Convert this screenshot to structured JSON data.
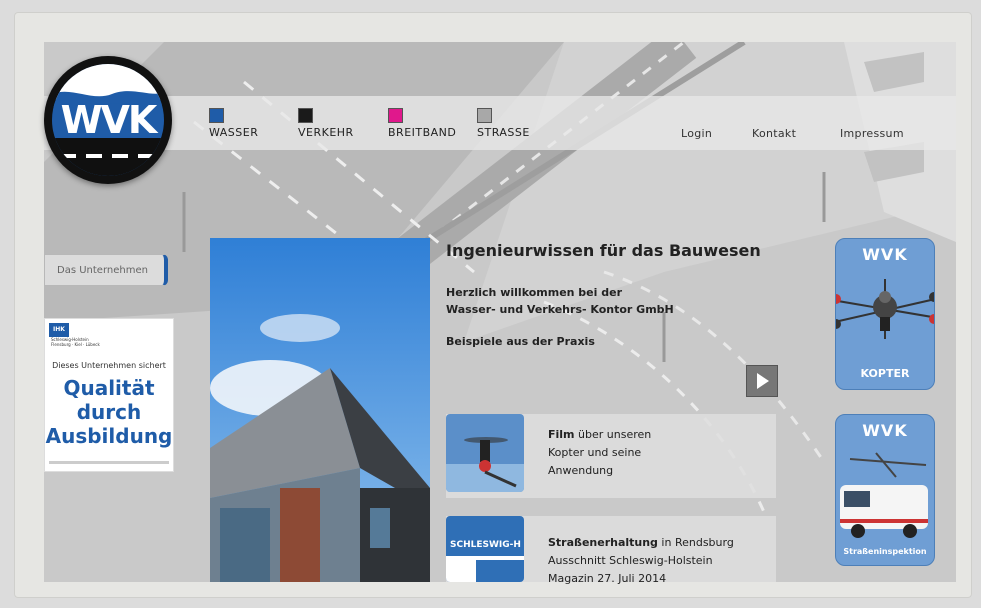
{
  "logo": {
    "text": "WVK"
  },
  "categories": [
    {
      "label": "WASSER",
      "color": "#1f5ca8"
    },
    {
      "label": "VERKEHR",
      "color": "#1a1a1a"
    },
    {
      "label": "BREITBAND",
      "color": "#e0188c"
    },
    {
      "label": "STRASSE",
      "color": "#a8a8a8"
    }
  ],
  "toplinks": {
    "login": "Login",
    "kontakt": "Kontakt",
    "impressum": "Impressum"
  },
  "sidebar": {
    "tab": "Das Unternehmen"
  },
  "ihk": {
    "badge": "IHK",
    "header": "Schleswig-Holstein",
    "region": "Flensburg · Kiel · Lübeck",
    "subtitle": "Dieses Unternehmen sichert",
    "line1": "Qualität",
    "line2": "durch",
    "line3": "Ausbildung"
  },
  "main": {
    "headline": "Ingenieurwissen für das Bauwesen",
    "intro1": "Herzlich willkommen bei der",
    "intro2": "Wasser- und Verkehrs- Kontor GmbH",
    "examples": "Beispiele aus der Praxis"
  },
  "cards": [
    {
      "title": "Film",
      "rest": " über unseren",
      "line2": "Kopter und seine",
      "line3": "Anwendung"
    },
    {
      "title": "Straßenerhaltung",
      "rest": " in Rendsburg",
      "line2": "Ausschnitt Schleswig-Holstein",
      "line3": "Magazin 27. Juli 2014",
      "thumb_text": "SCHLESWIG-H"
    }
  ],
  "sideboxes": [
    {
      "brand": "WVK",
      "label": "KOPTER"
    },
    {
      "brand": "WVK",
      "label": "Straßeninspektion"
    }
  ]
}
